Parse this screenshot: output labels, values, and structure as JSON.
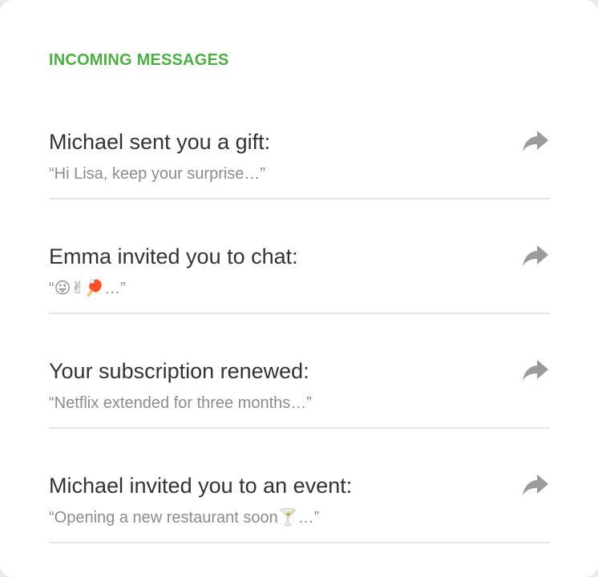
{
  "section": {
    "title": "INCOMING MESSAGES"
  },
  "messages": [
    {
      "title": "Michael sent you a gift:",
      "preview": "“Hi Lisa, keep your surprise…”",
      "action_icon": "forward-arrow-icon"
    },
    {
      "title": "Emma invited you to chat:",
      "preview": "“😜✌🏓…”",
      "action_icon": "forward-arrow-icon"
    },
    {
      "title": "Your subscription renewed:",
      "preview": "“Netflix extended for three months…”",
      "action_icon": "forward-arrow-icon"
    },
    {
      "title": "Michael invited you to an event:",
      "preview": "“Opening a new restaurant soon🍸…”",
      "action_icon": "forward-arrow-icon"
    }
  ],
  "colors": {
    "accent": "#4caf43",
    "title_text": "#333333",
    "preview_text": "#8c8c8c",
    "icon": "#9b9b9b",
    "divider": "#e6e6e6"
  }
}
